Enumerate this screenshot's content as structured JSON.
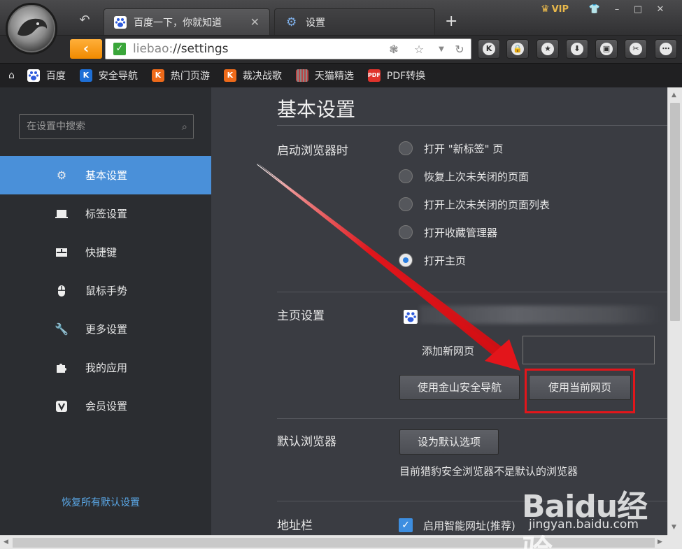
{
  "tabs": [
    {
      "title": "百度一下，你就知道"
    },
    {
      "title": "设置"
    }
  ],
  "vip_label": "VIP",
  "address": {
    "scheme": "liebao:",
    "path": "//settings"
  },
  "bookmarks": [
    {
      "label": "百度",
      "icon": "baidu-icon",
      "color": "#2e5bdc"
    },
    {
      "label": "安全导航",
      "icon": "k-shield-icon",
      "color": "#1e6fd6"
    },
    {
      "label": "热门页游",
      "icon": "k-icon",
      "color": "#ee6a1a"
    },
    {
      "label": "裁决战歌",
      "icon": "k-icon",
      "color": "#ee6a1a"
    },
    {
      "label": "天猫精选",
      "icon": "tmall-icon",
      "color": "#888888"
    },
    {
      "label": "PDF转换",
      "icon": "pdf-icon",
      "color": "#e0332c"
    }
  ],
  "sidebar": {
    "search_placeholder": "在设置中搜索",
    "items": [
      {
        "label": "基本设置",
        "icon": "gear-icon",
        "active": true
      },
      {
        "label": "标签设置",
        "icon": "laptop-icon"
      },
      {
        "label": "快捷键",
        "icon": "keyboard-icon"
      },
      {
        "label": "鼠标手势",
        "icon": "mouse-icon"
      },
      {
        "label": "更多设置",
        "icon": "wrench-icon"
      },
      {
        "label": "我的应用",
        "icon": "puzzle-icon"
      },
      {
        "label": "会员设置",
        "icon": "vip-v-icon"
      }
    ],
    "restore_label": "恢复所有默认设置"
  },
  "main": {
    "title": "基本设置",
    "startup": {
      "label": "启动浏览器时",
      "options": [
        "打开 \"新标签\" 页",
        "恢复上次未关闭的页面",
        "打开上次未关闭的页面列表",
        "打开收藏管理器",
        "打开主页"
      ],
      "selected_index": 4
    },
    "homepage": {
      "label": "主页设置",
      "add_label": "添加新网页",
      "btn_kingsoft": "使用金山安全导航",
      "btn_current": "使用当前网页"
    },
    "default_browser": {
      "label": "默认浏览器",
      "btn": "设为默认选项",
      "status": "目前猎豹安全浏览器不是默认的浏览器"
    },
    "address_bar": {
      "label": "地址栏",
      "checkbox_label": "启用智能网址(推荐)",
      "checked": true
    }
  },
  "watermark": {
    "brand": "Baidu经验",
    "url": "jingyan.baidu.com"
  },
  "colors": {
    "accent": "#4a90d9",
    "highlight_box": "#e2161b",
    "annotation_arrow": "#e3151b"
  }
}
